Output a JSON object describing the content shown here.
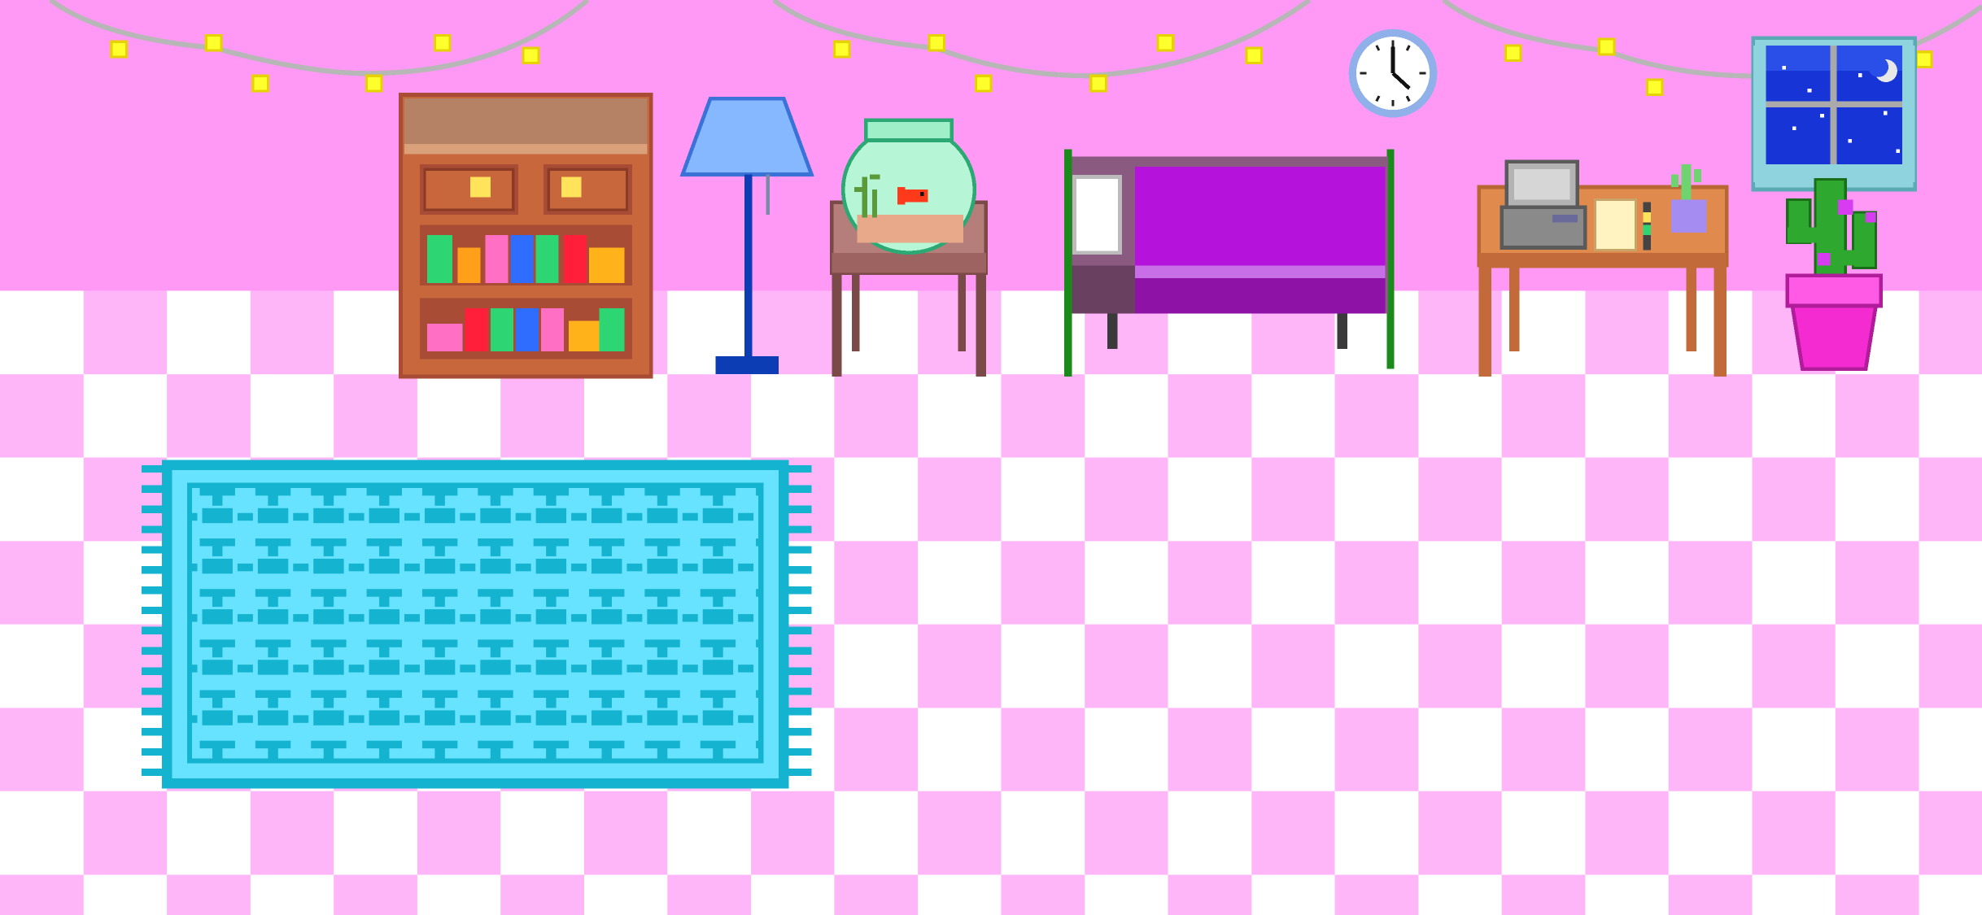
{
  "scene": {
    "name": "pixel-bedroom",
    "objects": [
      "string-lights",
      "wall-clock",
      "night-window",
      "bookshelf",
      "floor-lamp",
      "fishbowl",
      "side-table",
      "bed",
      "desk",
      "computer",
      "notepad",
      "small-cactus",
      "potted-cactus",
      "rug"
    ]
  },
  "colors": {
    "wall": "#ff99f5",
    "floor_pink": "#ffb6f9",
    "floor_white": "#ffffff",
    "light_bulb": "#ffff2e",
    "light_wire": "#b7b7b7",
    "wood": "#c8663c",
    "wood_dark": "#a94c35",
    "wood_top": "#b68265",
    "lamp_shade": "#86b8ff",
    "lamp_pole": "#0d3db4",
    "fishbowl_glass": "#b6f5d6",
    "fish": "#ff3a1a",
    "table_wood": "#9c6361",
    "bed_purple": "#b513dc",
    "bed_frame": "#8a5a80",
    "bed_post": "#1a8a1a",
    "desk_wood": "#e08a4d",
    "computer_gray": "#b3b3b3",
    "window_sky": "#1734d6",
    "window_frame": "#8ed3dd",
    "cactus_green": "#2ea82e",
    "pot_magenta": "#f32bd0",
    "rug_light": "#67e3ff",
    "rug_dark": "#14b3d0"
  }
}
